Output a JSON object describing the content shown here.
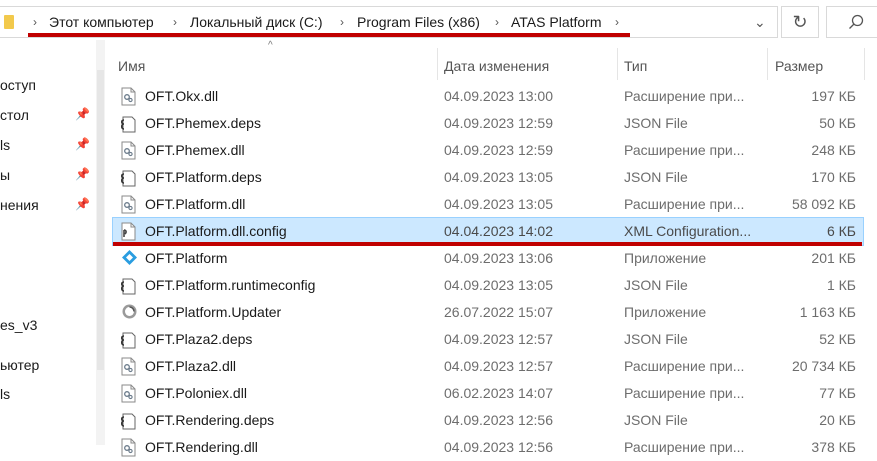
{
  "address_bar": {
    "crumbs": [
      "Этот компьютер",
      "Локальный диск (C:)",
      "Program Files (x86)",
      "ATAS Platform"
    ],
    "separator": "›"
  },
  "nav": {
    "items": [
      {
        "label": "оступ",
        "pinned": false
      },
      {
        "label": "стол",
        "pinned": true
      },
      {
        "label": "ls",
        "pinned": true
      },
      {
        "label": "ы",
        "pinned": true
      },
      {
        "label": "нения",
        "pinned": true
      },
      {
        "label": "es_v3",
        "pinned": false
      },
      {
        "label": "ьютер",
        "pinned": false
      },
      {
        "label": "ls",
        "pinned": false
      }
    ]
  },
  "columns": {
    "name": "Имя",
    "date": "Дата изменения",
    "type": "Тип",
    "size": "Размер"
  },
  "files": [
    {
      "name": "OFT.Okx.dll",
      "date": "04.09.2023 13:00",
      "type": "Расширение при...",
      "size": "197 КБ",
      "icon": "dll-icon"
    },
    {
      "name": "OFT.Phemex.deps",
      "date": "04.09.2023 12:59",
      "type": "JSON File",
      "size": "50 КБ",
      "icon": "json-icon"
    },
    {
      "name": "OFT.Phemex.dll",
      "date": "04.09.2023 12:59",
      "type": "Расширение при...",
      "size": "248 КБ",
      "icon": "dll-icon"
    },
    {
      "name": "OFT.Platform.deps",
      "date": "04.09.2023 13:05",
      "type": "JSON File",
      "size": "170 КБ",
      "icon": "json-icon"
    },
    {
      "name": "OFT.Platform.dll",
      "date": "04.09.2023 13:05",
      "type": "Расширение при...",
      "size": "58 092 КБ",
      "icon": "dll-icon"
    },
    {
      "name": "OFT.Platform.dll.config",
      "date": "04.04.2023 14:02",
      "type": "XML Configuration...",
      "size": "6 КБ",
      "icon": "config-icon",
      "selected": true
    },
    {
      "name": "OFT.Platform",
      "date": "04.09.2023 13:06",
      "type": "Приложение",
      "size": "201 КБ",
      "icon": "atas-app-icon"
    },
    {
      "name": "OFT.Platform.runtimeconfig",
      "date": "04.09.2023 13:05",
      "type": "JSON File",
      "size": "1 КБ",
      "icon": "json-icon"
    },
    {
      "name": "OFT.Platform.Updater",
      "date": "26.07.2022 15:07",
      "type": "Приложение",
      "size": "1 163 КБ",
      "icon": "updater-app-icon"
    },
    {
      "name": "OFT.Plaza2.deps",
      "date": "04.09.2023 12:57",
      "type": "JSON File",
      "size": "52 КБ",
      "icon": "json-icon"
    },
    {
      "name": "OFT.Plaza2.dll",
      "date": "04.09.2023 12:57",
      "type": "Расширение при...",
      "size": "20 734 КБ",
      "icon": "dll-icon"
    },
    {
      "name": "OFT.Poloniex.dll",
      "date": "06.02.2023 14:07",
      "type": "Расширение при...",
      "size": "77 КБ",
      "icon": "dll-icon"
    },
    {
      "name": "OFT.Rendering.deps",
      "date": "04.09.2023 12:56",
      "type": "JSON File",
      "size": "20 КБ",
      "icon": "json-icon"
    },
    {
      "name": "OFT.Rendering.dll",
      "date": "04.09.2023 12:56",
      "type": "Расширение при...",
      "size": "378 КБ",
      "icon": "dll-icon"
    }
  ],
  "colors": {
    "selection": "#cce8ff",
    "annotation_red": "#c00000"
  }
}
